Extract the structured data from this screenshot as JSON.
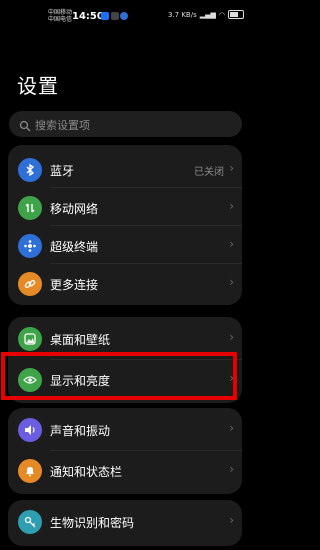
{
  "status": {
    "carrier1": "中国移动",
    "carrier2": "中国电信",
    "time": "14:50",
    "speed": "3.7 KB/s",
    "battery": "⁠"
  },
  "page": {
    "title": "设置"
  },
  "search": {
    "placeholder": "搜索设置项"
  },
  "groups": [
    {
      "items": [
        {
          "label": "蓝牙",
          "value": "已关闭",
          "icon": "bluetooth-icon"
        },
        {
          "label": "移动网络",
          "icon": "mobile-network-icon"
        },
        {
          "label": "超级终端",
          "icon": "super-device-icon"
        },
        {
          "label": "更多连接",
          "icon": "link-icon"
        }
      ]
    },
    {
      "items": [
        {
          "label": "桌面和壁纸",
          "icon": "wallpaper-icon"
        },
        {
          "label": "显示和亮度",
          "icon": "eye-icon"
        }
      ]
    },
    {
      "items": [
        {
          "label": "声音和振动",
          "icon": "speaker-icon"
        },
        {
          "label": "通知和状态栏",
          "icon": "bell-icon"
        }
      ]
    },
    {
      "items": [
        {
          "label": "生物识别和密码",
          "icon": "key-icon"
        }
      ]
    }
  ],
  "colors": {
    "bluetooth": "#2f6fd8",
    "mobile": "#3fa34a",
    "super": "#2f6fd8",
    "more": "#e58a26",
    "wallpaper": "#3fa34a",
    "display": "#3fa34a",
    "sound": "#6a5de0",
    "notify": "#e58a26",
    "bio": "#2e9fb0",
    "highlight": "#e60000"
  }
}
